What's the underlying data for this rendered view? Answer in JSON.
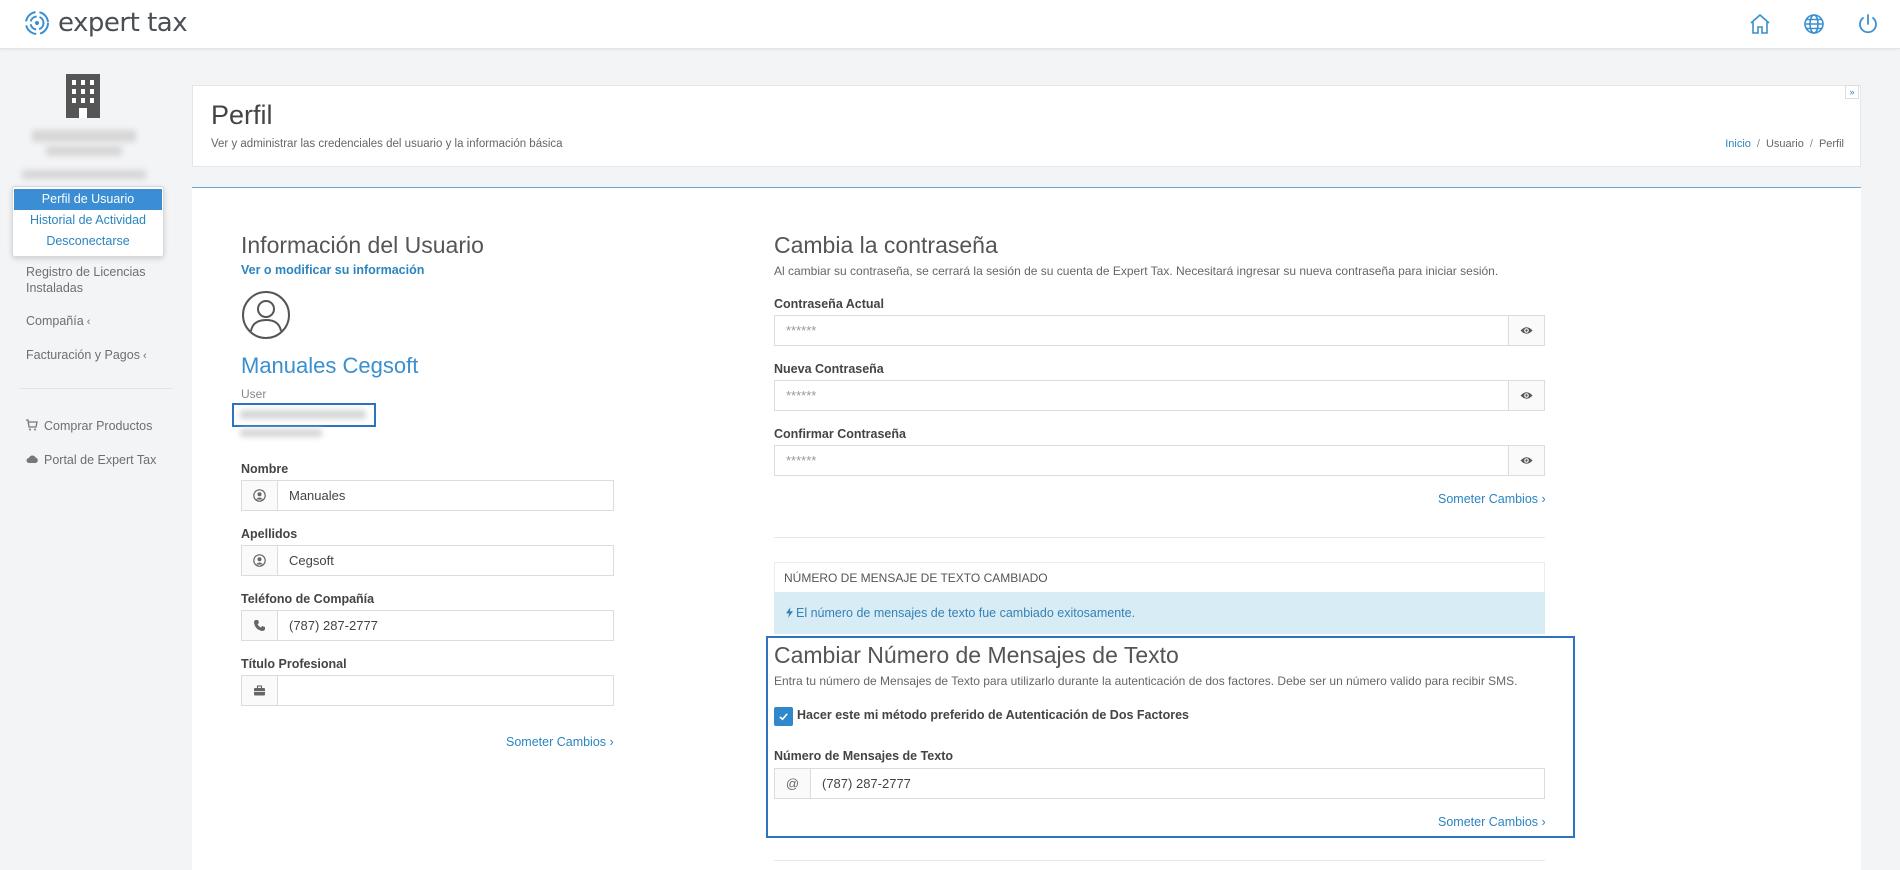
{
  "app": {
    "name": "expert tax"
  },
  "colors": {
    "accent": "#2a85c0",
    "highlight": "#2d73bf",
    "alert_bg": "#d8ecf6"
  },
  "topbar": {
    "icons": [
      "home-icon",
      "globe-icon",
      "power-icon"
    ]
  },
  "sidebar": {
    "menu": [
      "Perfil de Usuario",
      "Historial de Actividad",
      "Desconectarse"
    ],
    "items": [
      {
        "label": "Registro de Licencias Instaladas"
      },
      {
        "label": "Compañía",
        "chevron": "‹"
      },
      {
        "label": "Facturación y Pagos",
        "chevron": "‹"
      },
      {
        "label": "Comprar Productos",
        "icon": "cart-icon"
      },
      {
        "label": "Portal de Expert Tax",
        "icon": "cloud-icon"
      }
    ]
  },
  "header": {
    "title": "Perfil",
    "subtitle": "Ver y administrar las credenciales del usuario y la información básica",
    "breadcrumb": [
      "Inicio",
      "Usuario",
      "Perfil"
    ],
    "separator": "/"
  },
  "user_info": {
    "title": "Información del Usuario",
    "link": "Ver o modificar su información",
    "name": "Manuales Cegsoft",
    "role": "User",
    "fields": [
      {
        "label": "Nombre",
        "value": "Manuales",
        "icon": "user-circle-icon"
      },
      {
        "label": "Apellidos",
        "value": "Cegsoft",
        "icon": "user-circle-icon"
      },
      {
        "label": "Teléfono de Compañía",
        "value": "(787) 287-2777",
        "icon": "phone-icon"
      },
      {
        "label": "Título Profesional",
        "value": "",
        "icon": "briefcase-icon"
      }
    ],
    "submit": "Someter Cambios ›"
  },
  "password": {
    "title": "Cambia la contraseña",
    "description": "Al cambiar su contraseña, se cerrará la sesión de su cuenta de Expert Tax. Necesitará ingresar su nueva contraseña para iniciar sesión.",
    "fields": [
      {
        "label": "Contraseña Actual",
        "placeholder": "******"
      },
      {
        "label": "Nueva Contraseña",
        "placeholder": "******"
      },
      {
        "label": "Confirmar Contraseña",
        "placeholder": "******"
      }
    ],
    "submit": "Someter Cambios ›"
  },
  "alert": {
    "title": "NÚMERO DE MENSAJE DE TEXTO CAMBIADO",
    "message": "El número de mensajes de texto fue cambiado exitosamente."
  },
  "sms": {
    "title": "Cambiar Número de Mensajes de Texto",
    "description": "Entra tu número de Mensajes de Texto para utilizarlo durante la autenticación de dos factores. Debe ser un número valido para recibir SMS.",
    "checkbox_label": "Hacer este mi método preferido de Autenticación de Dos Factores",
    "checked": true,
    "field_label": "Número de Mensajes de Texto",
    "addon": "@",
    "value": "(787) 287-2777",
    "submit": "Someter Cambios ›"
  }
}
